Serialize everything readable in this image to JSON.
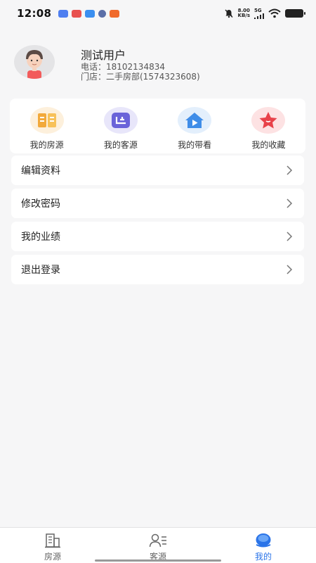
{
  "status_bar": {
    "time": "12:08",
    "speed_value": "8.00",
    "speed_unit": "KB/s",
    "network": "5G"
  },
  "profile": {
    "name": "测试用户",
    "phone_line": "电话：18102134834",
    "store_line": "门店：二手房部(1574323608)"
  },
  "quick_links": [
    {
      "label": "我的房源",
      "icon": "book-icon",
      "color": "#f2a93b"
    },
    {
      "label": "我的客源",
      "icon": "customer-icon",
      "color": "#6a63d9"
    },
    {
      "label": "我的带看",
      "icon": "house-play-icon",
      "color": "#3f8de8"
    },
    {
      "label": "我的收藏",
      "icon": "star-icon",
      "color": "#e8424a"
    }
  ],
  "menu": [
    {
      "label": "编辑资料"
    },
    {
      "label": "修改密码"
    },
    {
      "label": "我的业绩"
    },
    {
      "label": "退出登录"
    }
  ],
  "tabs": [
    {
      "label": "房源",
      "icon": "building-icon",
      "active": false
    },
    {
      "label": "客源",
      "icon": "contacts-icon",
      "active": false
    },
    {
      "label": "我的",
      "icon": "profile-icon",
      "active": true
    }
  ],
  "colors": {
    "accent": "#2b74e8",
    "background": "#f6f6f7"
  }
}
